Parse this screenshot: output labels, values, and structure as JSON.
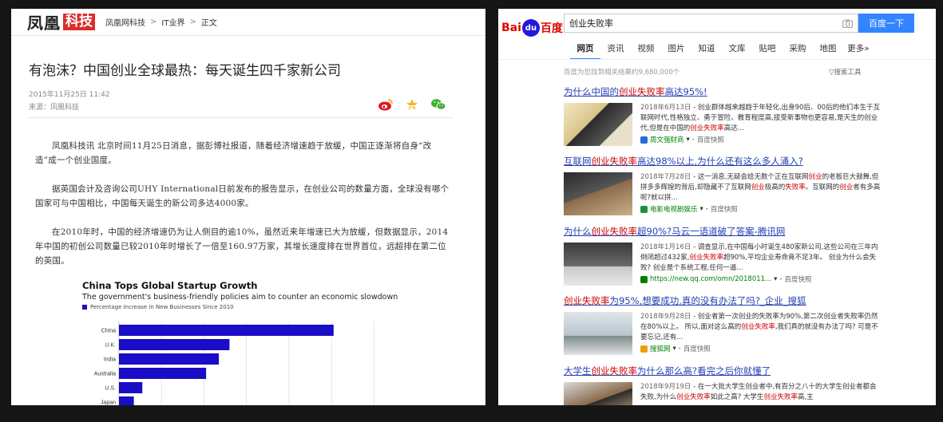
{
  "left": {
    "logo_main": "凤凰",
    "logo_tag": "科技",
    "breadcrumbs": [
      "凤凰网科技",
      "IT业界",
      "正文"
    ],
    "breadcrumb_sep": ">",
    "title": "有泡沫？中国创业全球最热：每天诞生四千家新公司",
    "date": "2015年11月25日 11:42",
    "source": "来源：凤凰科技",
    "paragraphs": [
      "凤凰科技讯 北京时间11月25日消息，据彭博社报道，随着经济增速趋于放缓，中国正逐渐将自身“改造”成一个创业国度。",
      "据英国会计及咨询公司UHY International日前发布的报告显示，在创业公司的数量方面，全球没有哪个国家可与中国相比，中国每天诞生的新公司多达4000家。",
      "在2010年时，中国的经济增速仍为让人侧目的逾10%，虽然近来年增速已大为放缓，但数据显示，2014年中国的初创公司数量已较2010年时增长了一倍至160.97万家，其增长速度排在世界首位，远超排在第二位的英国。"
    ],
    "chart_data": {
      "type": "bar",
      "orientation": "horizontal",
      "title": "China Tops Global Startup Growth",
      "subtitle": "The government's business-friendly policies aim to counter an economic slowdown",
      "series": [
        {
          "name": "Percentage Increase in New Businesses Since 2010",
          "values": [
            101,
            52,
            47,
            41,
            11,
            7
          ]
        }
      ],
      "categories": [
        "China",
        "U.K.",
        "India",
        "Australia",
        "U.S.",
        "Japan"
      ],
      "xlim": [
        0,
        130
      ],
      "grid": true,
      "bar_color": "#1a0dc7"
    }
  },
  "right": {
    "logo_left": "Bai",
    "logo_paw": "du",
    "logo_right": "百度",
    "query": "创业失败率",
    "search_button": "百度一下",
    "tabs": [
      "网页",
      "资讯",
      "视频",
      "图片",
      "知道",
      "文库",
      "贴吧",
      "采购",
      "地图",
      "更多»"
    ],
    "active_tab": "网页",
    "result_count": "百度为您找到相关结果约9,680,000个",
    "search_tools": "搜索工具",
    "cache_label": "百度快照",
    "results": [
      {
        "title_parts": [
          "为什么中国的",
          "创业失败率",
          "高达95%!"
        ],
        "date": "2018年6月13日",
        "snippet_parts": [
          "- 创业群体越来越趋于年轻化,出身90后、00后的他们本生于互联网时代,性格独立、勇于冒险、教育程度高,接受新事物也更容易,是天生的创业代,但是在中国的",
          "创业失败率",
          "高达..."
        ],
        "source": "周文强财商",
        "source_color": "#2a6bd6"
      },
      {
        "title_parts": [
          "互联网",
          "创业失败率",
          "高达98%以上,为什么还有这么多人涌入?"
        ],
        "date": "2018年7月28日",
        "snippet_parts": [
          "- 这一消息,无疑会给无数个正在互联网",
          "创业",
          "的老板巨大鼓舞,但拼多多辉煌的背后,却隐藏不了互联网",
          "创业",
          "极高的",
          "失败率",
          "。互联网的",
          "创业",
          "者有多高呢?就以拼..."
        ],
        "source": "电影电视剧娱乐",
        "source_color": "#1c8f3b"
      },
      {
        "title_parts": [
          "为什么",
          "创业失败率",
          "超90%?马云一语道破了答案-腾讯网"
        ],
        "date": "2018年1月16日",
        "snippet_parts": [
          "- 调查显示,在中国每小时诞生480家新公司,这些公司在三年内倒闭超过432家,",
          "创业失败率",
          "超90%,平均企业寿命竟不足3年。 创业为什么会失败? 创业是个系统工程,任何一逼..."
        ],
        "source": "https://new.qq.com/omn/2018011...",
        "source_color": "#008000"
      },
      {
        "title_parts": [
          "",
          "创业失败率",
          "为95%,想要成功,真的没有办法了吗?_企业_搜狐"
        ],
        "date": "2018年9月28日",
        "snippet_parts": [
          "- 创业者第一次创业的失败率为90%,第二次创业者失败率仍然在80%以上。 所以,面对这么高的",
          "创业失败率",
          ",我们真的就没有办法了吗? 可是不要忘记,还有..."
        ],
        "source": "搜狐网",
        "source_color": "#e6a20a"
      },
      {
        "title_parts": [
          "大学生",
          "创业失败率",
          "为什么那么高?看完之后你就懂了"
        ],
        "date": "2018年9月19日",
        "snippet_parts": [
          "- 在一大批大学生创业者中,有百分之八十的大学生创业者都会失败,为什么",
          "创业失败率",
          "如此之高? 大学生",
          "创业失败率",
          "高,主"
        ],
        "source": "",
        "source_color": "#999999"
      }
    ]
  }
}
